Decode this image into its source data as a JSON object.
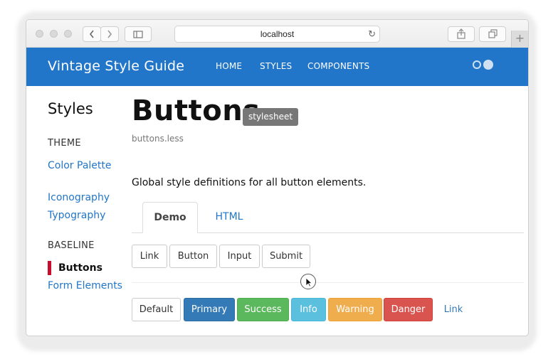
{
  "browser": {
    "url": "localhost",
    "back_icon": "chevron-left-icon",
    "forward_icon": "chevron-right-icon",
    "sidebar_icon": "sidebar-icon",
    "reload_icon": "reload-icon",
    "share_icon": "share-icon",
    "tabs_icon": "tabs-icon",
    "newtab_label": "+"
  },
  "header": {
    "brand": "Vintage Style Guide",
    "nav": [
      "HOME",
      "STYLES",
      "COMPONENTS"
    ],
    "toggle_icon": "theme-toggle-icon",
    "color": "#2276c9"
  },
  "sidebar": {
    "title": "Styles",
    "sections": [
      {
        "heading": "THEME",
        "items": [
          "Color Palette",
          "Iconography",
          "Typography"
        ]
      },
      {
        "heading": "BASELINE",
        "items": [
          "Buttons",
          "Form Elements"
        ],
        "active": "Buttons"
      }
    ],
    "accent": "#c8102e"
  },
  "main": {
    "title": "Buttons",
    "badge": "stylesheet",
    "filename": "buttons.less",
    "description": "Global style definitions for all button elements.",
    "tabs": [
      "Demo",
      "HTML"
    ],
    "active_tab": "Demo",
    "element_buttons": [
      "Link",
      "Button",
      "Input",
      "Submit"
    ],
    "variant_buttons": [
      {
        "label": "Default",
        "variant": "default"
      },
      {
        "label": "Primary",
        "variant": "primary",
        "color": "#337ab7"
      },
      {
        "label": "Success",
        "variant": "success",
        "color": "#5cb85c"
      },
      {
        "label": "Info",
        "variant": "info",
        "color": "#5bc0de"
      },
      {
        "label": "Warning",
        "variant": "warning",
        "color": "#f0ad4e"
      },
      {
        "label": "Danger",
        "variant": "danger",
        "color": "#d9534f"
      },
      {
        "label": "Link",
        "variant": "link"
      }
    ]
  }
}
